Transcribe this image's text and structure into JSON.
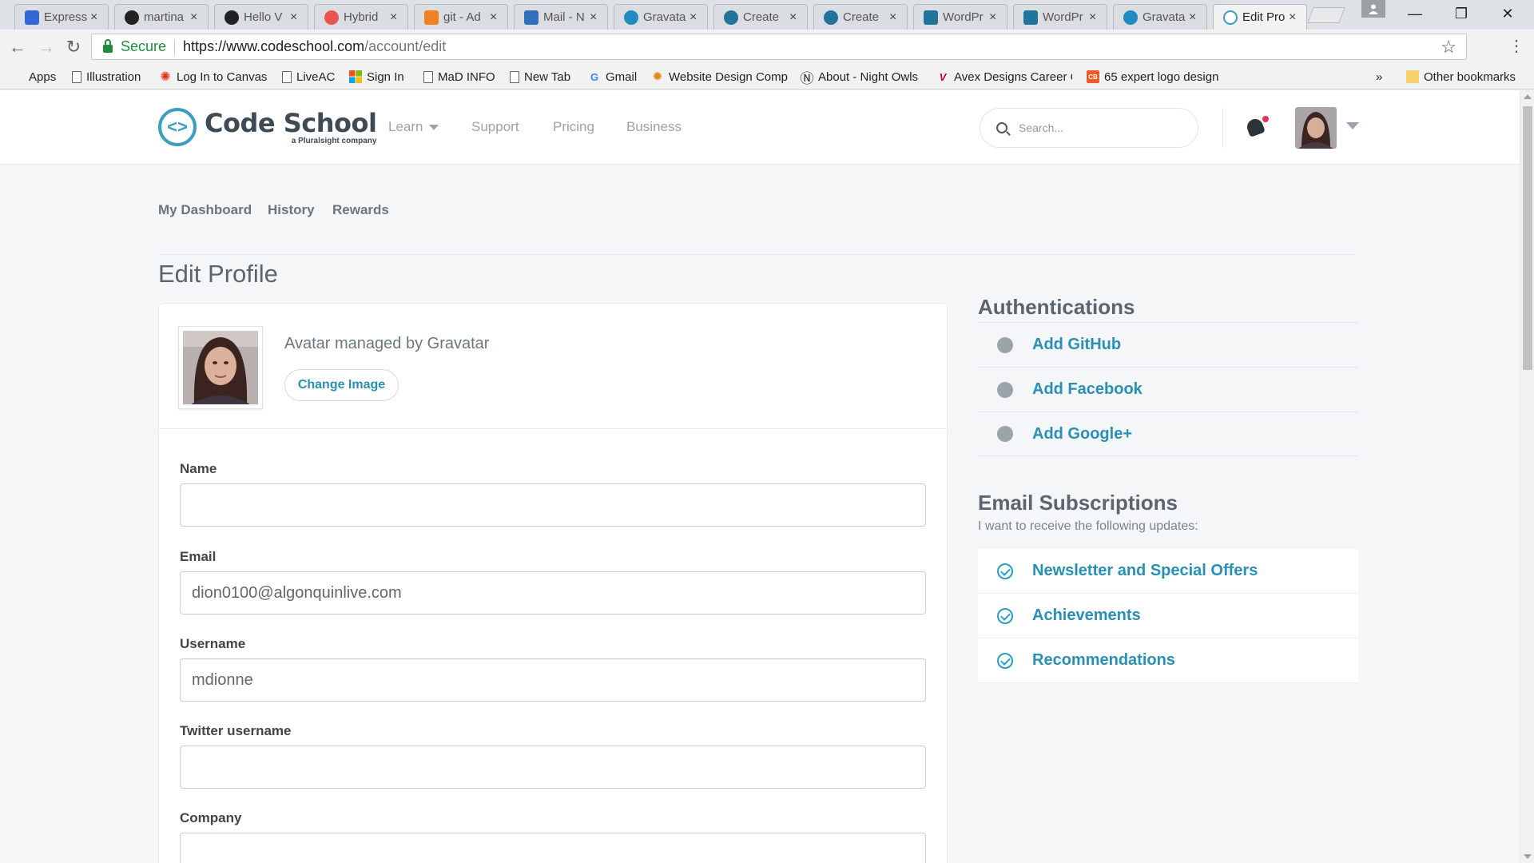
{
  "browser": {
    "tabs": [
      {
        "label": "Express",
        "icon_color": "#3367d6"
      },
      {
        "label": "martina",
        "icon_color": "#222222"
      },
      {
        "label": "Hello V",
        "icon_color": "#222222"
      },
      {
        "label": "Hybrid",
        "icon_color": "#e8554e"
      },
      {
        "label": "git - Ad",
        "icon_color": "#f48024"
      },
      {
        "label": "Mail - N",
        "icon_color": "#2f6fbd"
      },
      {
        "label": "Gravata",
        "icon_color": "#1e8cbe"
      },
      {
        "label": "Create",
        "icon_color": "#21759b"
      },
      {
        "label": "Create",
        "icon_color": "#21759b"
      },
      {
        "label": "WordPr",
        "icon_color": "#21759b"
      },
      {
        "label": "WordPr",
        "icon_color": "#21759b"
      },
      {
        "label": "Gravata",
        "icon_color": "#1e8cbe"
      },
      {
        "label": "Edit Pro",
        "icon_color": "#3b9ec1",
        "active": true
      }
    ],
    "tab_close_glyph": "×",
    "window_controls": {
      "minimize": "—",
      "restore": "❐",
      "close": "✕"
    },
    "nav": {
      "back": "←",
      "forward": "→",
      "reload": "↻"
    },
    "secure_label": "Secure",
    "url_host": "https://www.codeschool.com",
    "url_path": "/account/edit",
    "star_glyph": "☆",
    "menu_glyph": "⋮",
    "bookmarks": [
      {
        "label": "Apps",
        "icon": "apps-grid-icon"
      },
      {
        "label": "Illustration",
        "icon": "page-icon"
      },
      {
        "label": "Log In to Canvas",
        "icon": "canvas-icon",
        "glyph": "✺",
        "color": "#e3331c"
      },
      {
        "label": "LiveAC",
        "icon": "page-icon"
      },
      {
        "label": "Sign In",
        "icon": "microsoft-icon"
      },
      {
        "label": "MaD INFO",
        "icon": "page-icon"
      },
      {
        "label": "New Tab",
        "icon": "page-icon"
      },
      {
        "label": "Gmail",
        "icon": "google-icon",
        "glyph": "G",
        "color": "#4285f4"
      },
      {
        "label": "Website Design Comp",
        "icon": "award-icon",
        "glyph": "✹",
        "color": "#e28a14"
      },
      {
        "label": "About - Night Owls",
        "icon": "night-owls-icon",
        "glyph": "Ⓝ",
        "color": "#222222"
      },
      {
        "label": "Avex Designs Career C",
        "icon": "avex-icon",
        "glyph": "V",
        "color": "#d0021b"
      },
      {
        "label": "65 expert logo design",
        "icon": "creative-bloq-icon",
        "glyph": "CB",
        "color": "#f15a24"
      }
    ],
    "overflow_glyph": "»",
    "other_bookmarks": "Other bookmarks"
  },
  "site": {
    "brand_mark": "<>",
    "brand_name": "Code School",
    "brand_sub": "a Pluralsight company",
    "nav": [
      "Learn",
      "Support",
      "Pricing",
      "Business"
    ],
    "search_placeholder": "Search..."
  },
  "subnav": [
    "My Dashboard",
    "History",
    "Rewards"
  ],
  "page_title": "Edit Profile",
  "profile": {
    "avatar_caption": "Avatar managed by Gravatar",
    "change_image_label": "Change Image",
    "fields": [
      {
        "label": "Name",
        "value": ""
      },
      {
        "label": "Email",
        "value": "dion0100@algonquinlive.com"
      },
      {
        "label": "Username",
        "value": "mdionne"
      },
      {
        "label": "Twitter username",
        "value": ""
      },
      {
        "label": "Company",
        "value": ""
      }
    ]
  },
  "authentications": {
    "heading": "Authentications",
    "items": [
      "Add GitHub",
      "Add Facebook",
      "Add Google+"
    ]
  },
  "email_subscriptions": {
    "heading": "Email Subscriptions",
    "description": "I want to receive the following updates:",
    "items": [
      "Newsletter and Special Offers",
      "Achievements",
      "Recommendations"
    ]
  },
  "colors": {
    "accent": "#2a8fb5",
    "notification": "#e5325a"
  }
}
